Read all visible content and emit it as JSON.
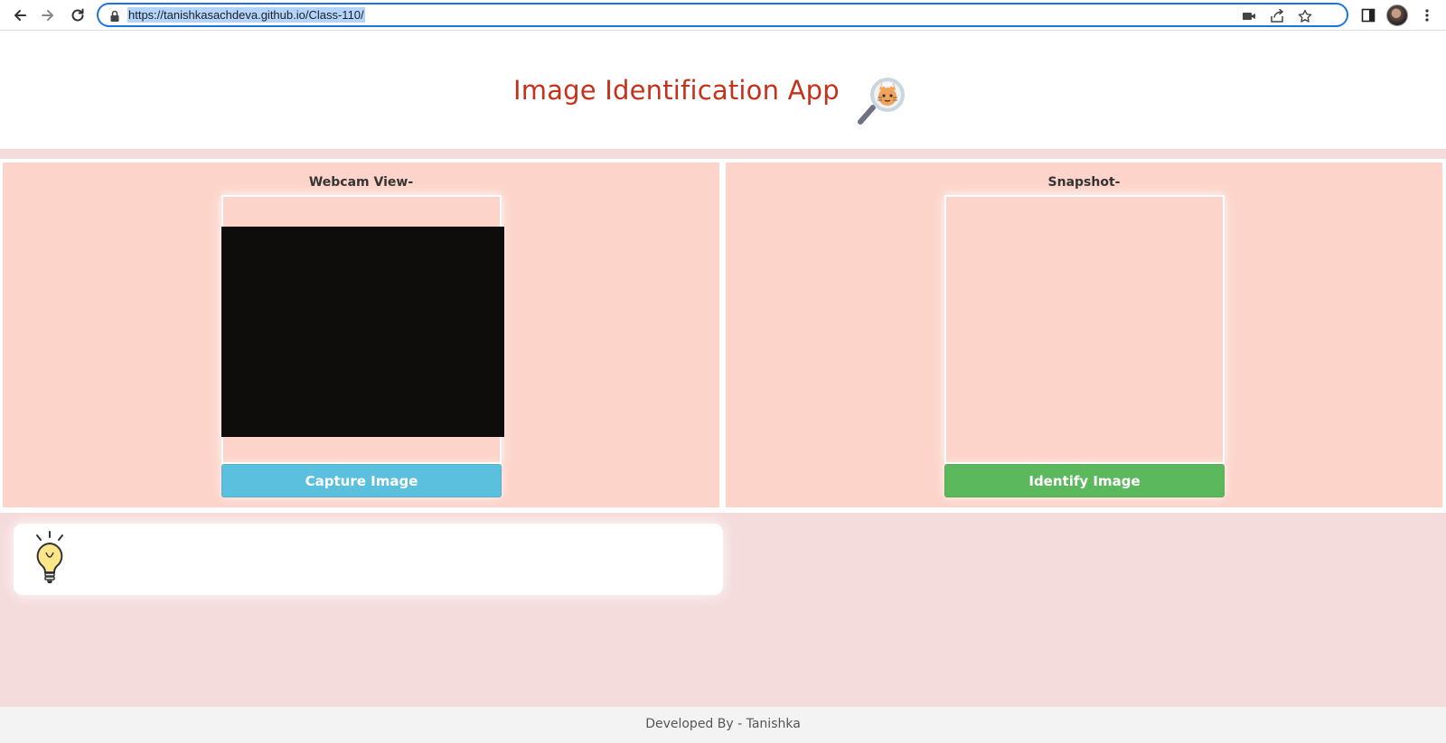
{
  "browser": {
    "url": "https://tanishkasachdeva.github.io/Class-110/",
    "icons": [
      "back-arrow-icon",
      "forward-arrow-icon",
      "reload-icon",
      "lock-icon",
      "camera-icon",
      "share-icon",
      "star-icon",
      "side-panel-icon",
      "profile-avatar",
      "kebab-menu-icon"
    ]
  },
  "header": {
    "title": "Image Identification App",
    "logo_icon": "magnifier-cat-icon",
    "title_color": "#c4321b"
  },
  "panels": {
    "webcam": {
      "label": "Webcam View-",
      "button": "Capture Image",
      "button_color": "#5bc0de"
    },
    "snapshot": {
      "label": "Snapshot-",
      "button": "Identify Image",
      "button_color": "#5cb85c"
    },
    "panel_color": "#fdd4ca"
  },
  "result": {
    "icon": "lightbulb-icon",
    "text": ""
  },
  "footer": {
    "text": "Developed By - Tanishka"
  }
}
